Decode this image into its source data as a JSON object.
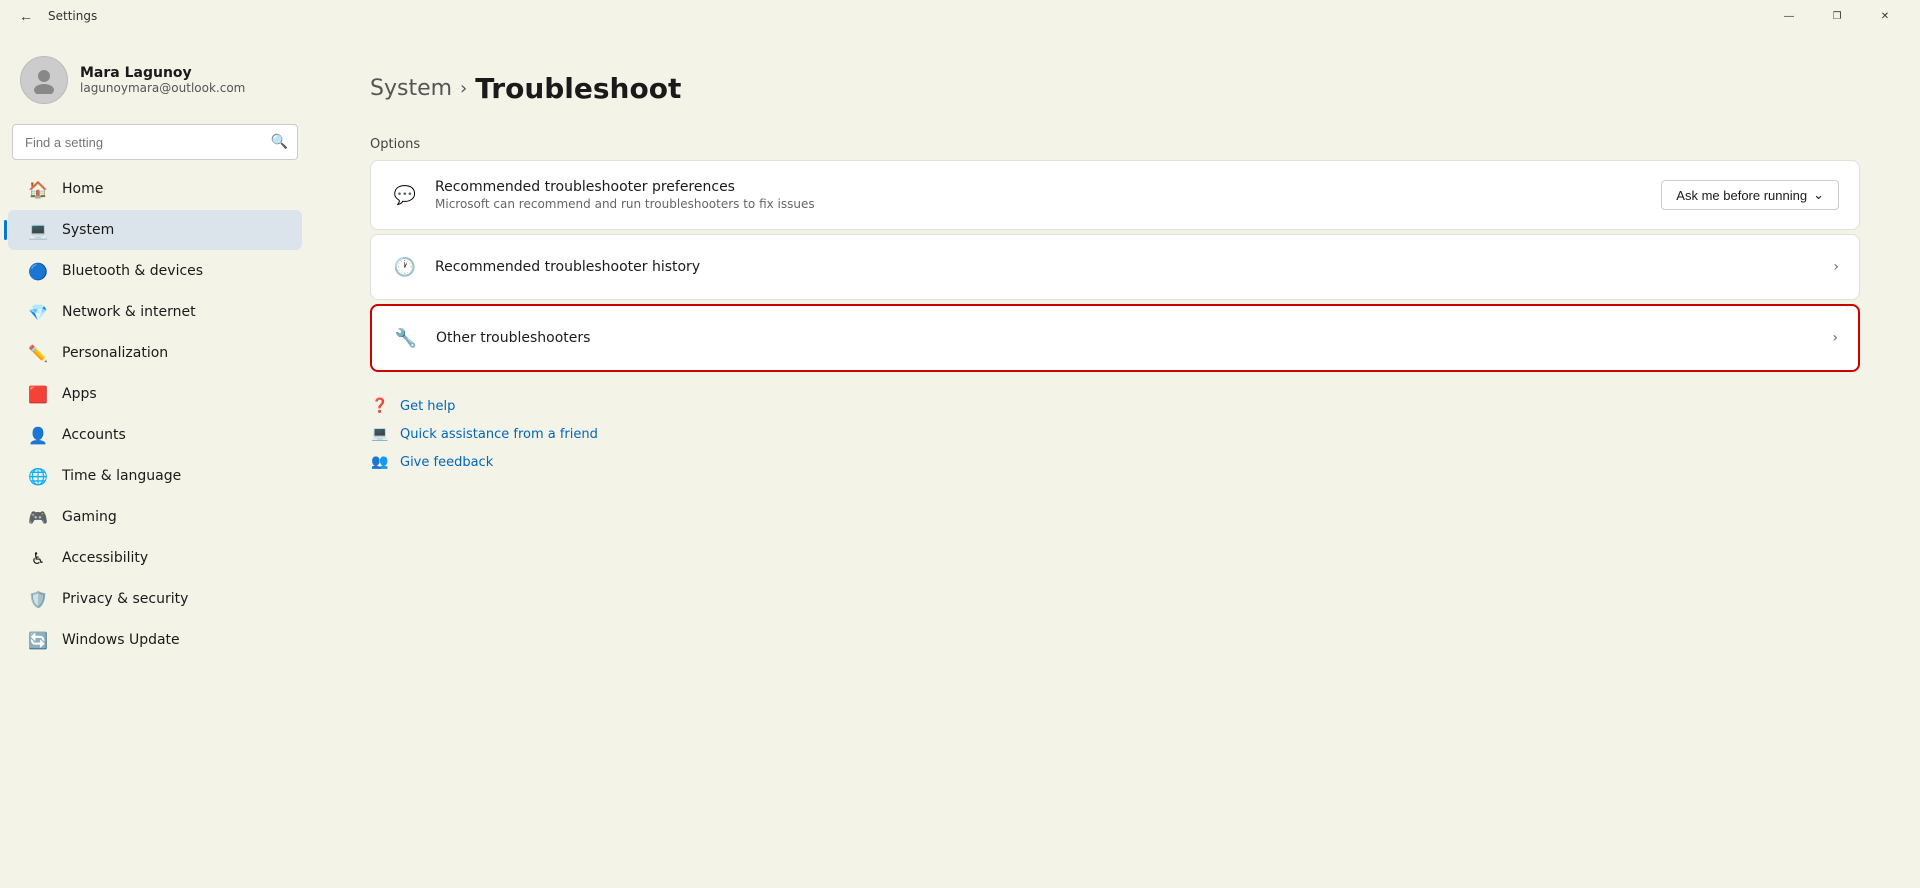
{
  "titlebar": {
    "app_title": "Settings",
    "minimize_label": "—",
    "restore_label": "❐",
    "close_label": "✕"
  },
  "sidebar": {
    "user": {
      "name": "Mara Lagunoy",
      "email": "lagunoymara@outlook.com"
    },
    "search_placeholder": "Find a setting",
    "nav_items": [
      {
        "id": "home",
        "label": "Home",
        "icon": "🏠"
      },
      {
        "id": "system",
        "label": "System",
        "icon": "💻",
        "active": true
      },
      {
        "id": "bluetooth",
        "label": "Bluetooth & devices",
        "icon": "🔵"
      },
      {
        "id": "network",
        "label": "Network & internet",
        "icon": "💎"
      },
      {
        "id": "personalization",
        "label": "Personalization",
        "icon": "✏️"
      },
      {
        "id": "apps",
        "label": "Apps",
        "icon": "🟥"
      },
      {
        "id": "accounts",
        "label": "Accounts",
        "icon": "👤"
      },
      {
        "id": "time",
        "label": "Time & language",
        "icon": "🌐"
      },
      {
        "id": "gaming",
        "label": "Gaming",
        "icon": "🎮"
      },
      {
        "id": "accessibility",
        "label": "Accessibility",
        "icon": "♿"
      },
      {
        "id": "privacy",
        "label": "Privacy & security",
        "icon": "🛡️"
      },
      {
        "id": "update",
        "label": "Windows Update",
        "icon": "🔄"
      }
    ]
  },
  "content": {
    "breadcrumb_parent": "System",
    "breadcrumb_separator": ">",
    "breadcrumb_current": "Troubleshoot",
    "section_label": "Options",
    "options": [
      {
        "id": "recommended-prefs",
        "icon": "💬",
        "title": "Recommended troubleshooter preferences",
        "subtitle": "Microsoft can recommend and run troubleshooters to fix issues",
        "action_type": "dropdown",
        "action_label": "Ask me before running",
        "highlighted": false
      },
      {
        "id": "recommended-history",
        "icon": "🕐",
        "title": "Recommended troubleshooter history",
        "subtitle": "",
        "action_type": "chevron",
        "highlighted": false
      },
      {
        "id": "other-troubleshooters",
        "icon": "🔧",
        "title": "Other troubleshooters",
        "subtitle": "",
        "action_type": "chevron",
        "highlighted": true
      }
    ],
    "help_links": [
      {
        "id": "get-help",
        "icon": "❓",
        "label": "Get help"
      },
      {
        "id": "quick-assistance",
        "icon": "💻",
        "label": "Quick assistance from a friend"
      },
      {
        "id": "give-feedback",
        "icon": "👥",
        "label": "Give feedback"
      }
    ]
  }
}
